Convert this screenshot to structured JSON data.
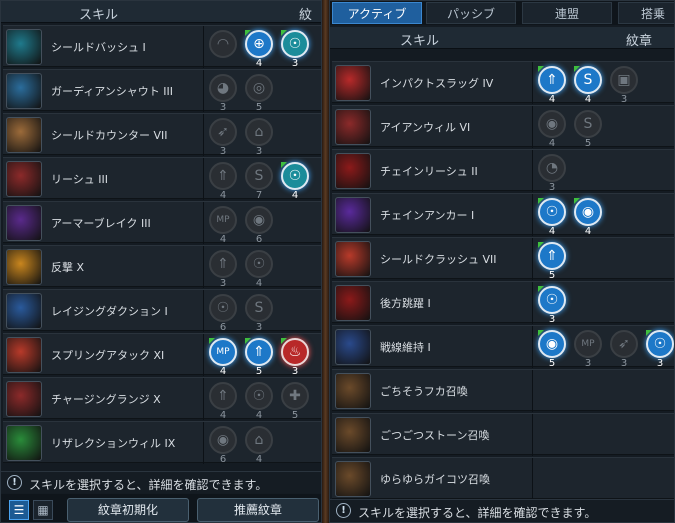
{
  "left_panel": {
    "header": {
      "skill": "スキル",
      "glyph": "紋章"
    },
    "rows": [
      {
        "name": "シールドバッシュ I",
        "icon_color": "#1f7a8c",
        "glyphs": [
          {
            "count": "",
            "on": false,
            "symbol": "◠"
          },
          {
            "count": "4",
            "on": true,
            "symbol": "⊕"
          },
          {
            "count": "3",
            "on": true,
            "symbol": "☉",
            "style": "teal"
          }
        ]
      },
      {
        "name": "ガーディアンシャウト III",
        "icon_color": "#2b6d9c",
        "glyphs": [
          {
            "count": "3",
            "on": false,
            "symbol": "◕"
          },
          {
            "count": "5",
            "on": false,
            "symbol": "◎"
          }
        ]
      },
      {
        "name": "シールドカウンター VII",
        "icon_color": "#9c6b3a",
        "glyphs": [
          {
            "count": "3",
            "on": false,
            "symbol": "➶"
          },
          {
            "count": "3",
            "on": false,
            "symbol": "⌂"
          }
        ]
      },
      {
        "name": "リーシュ III",
        "icon_color": "#8c2a2a",
        "glyphs": [
          {
            "count": "4",
            "on": false,
            "symbol": "⇑"
          },
          {
            "count": "7",
            "on": false,
            "symbol": "S"
          },
          {
            "count": "4",
            "on": true,
            "symbol": "☉",
            "style": "teal"
          }
        ]
      },
      {
        "name": "アーマーブレイク III",
        "icon_color": "#5a2a8c",
        "glyphs": [
          {
            "count": "4",
            "on": false,
            "symbol": "MP"
          },
          {
            "count": "6",
            "on": false,
            "symbol": "◉"
          }
        ]
      },
      {
        "name": "反撃 X",
        "icon_color": "#c9861e",
        "glyphs": [
          {
            "count": "3",
            "on": false,
            "symbol": "⇑"
          },
          {
            "count": "4",
            "on": false,
            "symbol": "☉"
          }
        ]
      },
      {
        "name": "レイジングダクション I",
        "icon_color": "#2a5a9c",
        "glyphs": [
          {
            "count": "6",
            "on": false,
            "symbol": "☉"
          },
          {
            "count": "3",
            "on": false,
            "symbol": "S"
          }
        ]
      },
      {
        "name": "スプリングアタック XI",
        "icon_color": "#b83a2a",
        "glyphs": [
          {
            "count": "4",
            "on": true,
            "symbol": "MP"
          },
          {
            "count": "5",
            "on": true,
            "symbol": "⇑"
          },
          {
            "count": "3",
            "on": true,
            "symbol": "♨",
            "style": "red"
          }
        ]
      },
      {
        "name": "チャージングランジ X",
        "icon_color": "#8c2a2a",
        "glyphs": [
          {
            "count": "4",
            "on": false,
            "symbol": "⇑"
          },
          {
            "count": "4",
            "on": false,
            "symbol": "☉"
          },
          {
            "count": "5",
            "on": false,
            "symbol": "✚"
          }
        ]
      },
      {
        "name": "リザレクションウィル IX",
        "icon_color": "#2a8c3a",
        "glyphs": [
          {
            "count": "6",
            "on": false,
            "symbol": "◉"
          },
          {
            "count": "4",
            "on": false,
            "symbol": "⌂"
          }
        ]
      }
    ],
    "info_text": "スキルを選択すると、詳細を確認できます。",
    "buttons": {
      "reset": "紋章初期化",
      "recommend": "推薦紋章"
    }
  },
  "right_panel": {
    "tabs": [
      "アクティブ",
      "パッシブ",
      "連盟",
      "搭乗"
    ],
    "header": {
      "skill": "スキル",
      "glyph": "紋章"
    },
    "rows": [
      {
        "name": "インパクトスラッグ IV",
        "icon_color": "#b82a2a",
        "glyphs": [
          {
            "count": "4",
            "on": true,
            "symbol": "⇑"
          },
          {
            "count": "4",
            "on": true,
            "symbol": "S"
          },
          {
            "count": "3",
            "on": false,
            "symbol": "▣"
          }
        ]
      },
      {
        "name": "アイアンウィル VI",
        "icon_color": "#8c2a2a",
        "glyphs": [
          {
            "count": "4",
            "on": false,
            "symbol": "◉"
          },
          {
            "count": "5",
            "on": false,
            "symbol": "S"
          }
        ]
      },
      {
        "name": "チェインリーシュ II",
        "icon_color": "#8c1a1a",
        "glyphs": [
          {
            "count": "3",
            "on": false,
            "symbol": "◔"
          }
        ]
      },
      {
        "name": "チェインアンカー I",
        "icon_color": "#5a2a9c",
        "glyphs": [
          {
            "count": "4",
            "on": true,
            "symbol": "☉"
          },
          {
            "count": "4",
            "on": true,
            "symbol": "◉"
          }
        ]
      },
      {
        "name": "シールドクラッシュ VII",
        "icon_color": "#b83a2a",
        "glyphs": [
          {
            "count": "5",
            "on": true,
            "symbol": "⇑"
          }
        ]
      },
      {
        "name": "後方跳躍 I",
        "icon_color": "#8c1a1a",
        "glyphs": [
          {
            "count": "3",
            "on": true,
            "symbol": "☉"
          }
        ]
      },
      {
        "name": "戦線維持 I",
        "icon_color": "#2a4a8c",
        "glyphs": [
          {
            "count": "5",
            "on": true,
            "symbol": "◉"
          },
          {
            "count": "3",
            "on": false,
            "symbol": "MP"
          },
          {
            "count": "3",
            "on": false,
            "symbol": "➶"
          },
          {
            "count": "3",
            "on": true,
            "symbol": "☉"
          }
        ]
      },
      {
        "name": "ごちそうフカ召喚",
        "icon_color": "#6b4a2a",
        "glyphs": []
      },
      {
        "name": "ごつごつストーン召喚",
        "icon_color": "#6b4a2a",
        "glyphs": []
      },
      {
        "name": "ゆらゆらガイコツ召喚",
        "icon_color": "#6b4a2a",
        "glyphs": []
      }
    ],
    "info_text": "スキルを選択すると、詳細を確認できます。"
  },
  "info_icon": "!"
}
